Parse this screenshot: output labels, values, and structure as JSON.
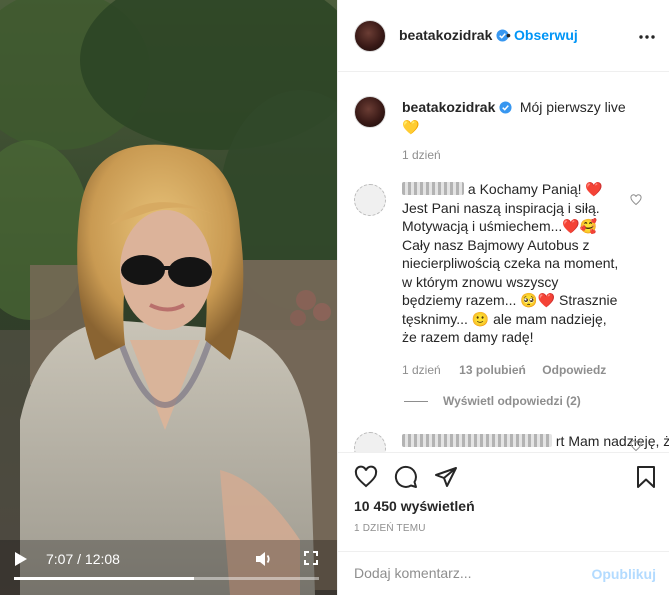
{
  "video": {
    "time_label": "7:07 / 12:08",
    "progress": 0.59
  },
  "post": {
    "username": "beatakozidrak",
    "follow_label": "Obserwuj",
    "dot": "•",
    "caption": "Mój pierwszy live",
    "caption_emoji": "💛",
    "caption_age": "1 dzień"
  },
  "comments": [
    {
      "text": "a Kochamy Panią! ❤️ Jest Pani naszą inspiracją i siłą. Motywacją i uśmiechem...❤️🥰 Cały nasz Bajmowy Autobus z niecierpliwością czeka na moment, w którym znowu wszyscy będziemy razem... 🥺❤️ Strasznie tęsknimy... 🙂 ale mam nadzieję, że razem damy radę!",
      "age": "1 dzień",
      "likes": "13 polubień",
      "reply_label": "Odpowiedz",
      "view_replies": "Wyświetl odpowiedzi (2)"
    },
    {
      "text": "rt Mam nadzieję, że"
    }
  ],
  "footer": {
    "views": "10 450 wyświetleń",
    "time_ago": "1 DZIEŃ TEMU",
    "comment_placeholder": "Dodaj komentarz...",
    "publish_label": "Opublikuj"
  },
  "colors": {
    "accent": "#0095f6",
    "publish_disabled": "#b3dbff",
    "like_red": "#ed4956"
  },
  "icons": [
    "play-icon",
    "volume-icon",
    "fullscreen-icon",
    "verified-icon",
    "more-icon",
    "heart-icon",
    "comment-icon",
    "share-icon",
    "bookmark-icon"
  ]
}
